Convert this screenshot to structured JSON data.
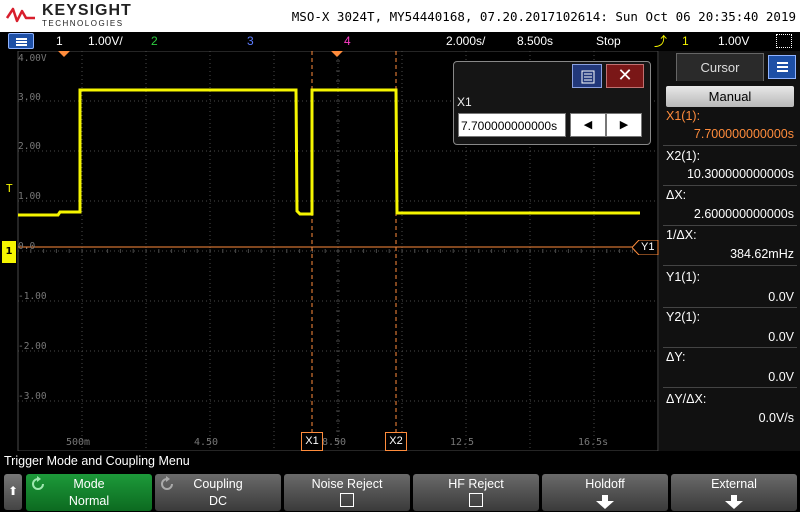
{
  "header": {
    "brand": "KEYSIGHT",
    "brand_sub": "TECHNOLOGIES",
    "model_info": "MSO-X 3024T, MY54440168, 07.20.2017102614: Sun Oct 06 20:35:40 2019"
  },
  "status": {
    "ch1_num": "1",
    "ch1_scale": "1.00V/",
    "ch2_num": "2",
    "ch3_num": "3",
    "ch4_num": "4",
    "timebase": "2.000s/",
    "delay": "8.500s",
    "run_state": "Stop",
    "trig_src": "1",
    "trig_level": "1.00V"
  },
  "colors": {
    "ch1": "#f5f500",
    "ch2": "#2ecc40",
    "ch3": "#5c7cff",
    "ch4": "#ff3cc8",
    "cursor_y": "#ff8c3c",
    "grid": "#555555",
    "accent_blue": "#1d4fa6"
  },
  "plot": {
    "y_labels": [
      "4.00V",
      "3.00",
      "2.00",
      "1.00",
      "0.0",
      "-1.00",
      "-2.00",
      "-3.00"
    ],
    "x_labels": [
      "500m",
      "4.50",
      "8.50",
      "12.5",
      "16.5s"
    ],
    "trigger_marker": "T",
    "ground_marker": "1",
    "cursor_x1_label": "X1",
    "cursor_x2_label": "X2",
    "cursor_y1_label": "Y1"
  },
  "dialog": {
    "label": "X1",
    "value": "7.700000000000s",
    "left_icon": "left-arrow-icon",
    "right_icon": "right-arrow-icon",
    "close_icon": "close-icon",
    "menu_icon": "menu-icon"
  },
  "panel": {
    "tab": "Cursor",
    "mode": "Manual",
    "x1_label": "X1(1):",
    "x1_value": "7.700000000000s",
    "x2_label": "X2(1):",
    "x2_value": "10.300000000000s",
    "dx_label": "ΔX:",
    "dx_value": "2.600000000000s",
    "inv_dx_label": "1/ΔX:",
    "inv_dx_value": "384.62mHz",
    "y1_label": "Y1(1):",
    "y1_value": "0.0V",
    "y2_label": "Y2(1):",
    "y2_value": "0.0V",
    "dy_label": "ΔY:",
    "dy_value": "0.0V",
    "dydx_label": "ΔY/ΔX:",
    "dydx_value": "0.0V/s"
  },
  "menu": {
    "title": "Trigger Mode and Coupling Menu",
    "softkeys": [
      {
        "title": "Mode",
        "value": "Normal"
      },
      {
        "title": "Coupling",
        "value": "DC"
      },
      {
        "title": "Noise Reject",
        "value": ""
      },
      {
        "title": "HF Reject",
        "value": ""
      },
      {
        "title": "Holdoff",
        "value": ""
      },
      {
        "title": "External",
        "value": ""
      }
    ]
  }
}
